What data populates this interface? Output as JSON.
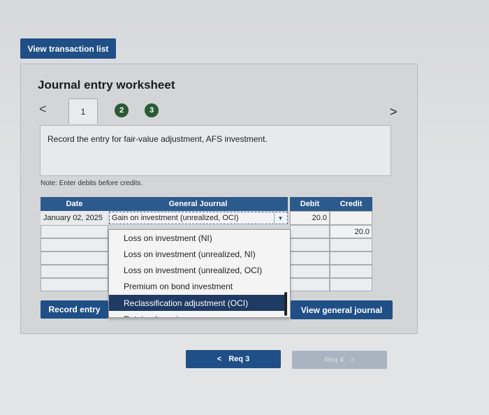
{
  "toolbar": {
    "view_transaction_list": "View transaction list"
  },
  "worksheet": {
    "title": "Journal entry worksheet",
    "nav_prev": "<",
    "nav_next": ">",
    "tabs": [
      {
        "label": "1",
        "state": "active"
      },
      {
        "label": "2",
        "state": "completed"
      },
      {
        "label": "3",
        "state": "completed"
      }
    ],
    "instruction": "Record the entry for fair-value adjustment, AFS investment.",
    "note": "Note: Enter debits before credits."
  },
  "journal": {
    "headers": {
      "date": "Date",
      "general_journal": "General Journal",
      "debit": "Debit",
      "credit": "Credit"
    },
    "rows": [
      {
        "date": "January 02, 2025",
        "account": "Gain on investment (unrealized, OCI)",
        "debit": "20.0",
        "credit": ""
      },
      {
        "date": "",
        "account": "",
        "debit": "",
        "credit": "20.0"
      }
    ]
  },
  "dropdown": {
    "items": [
      "Loss on investment (NI)",
      "Loss on investment (unrealized, NI)",
      "Loss on investment (unrealized, OCI)",
      "Premium on bond investment",
      "Reclassification adjustment (OCI)",
      "Retained earnings"
    ],
    "selected_index": 4
  },
  "buttons": {
    "record_entry": "Record entry",
    "view_general_journal": "View general journal",
    "req_prev": "Req 3",
    "req_next": "Req 4"
  },
  "colors": {
    "primary": "#1f4f86",
    "header": "#2d5a8c",
    "tab_done": "#2a5a35",
    "selected": "#1f3a63"
  }
}
